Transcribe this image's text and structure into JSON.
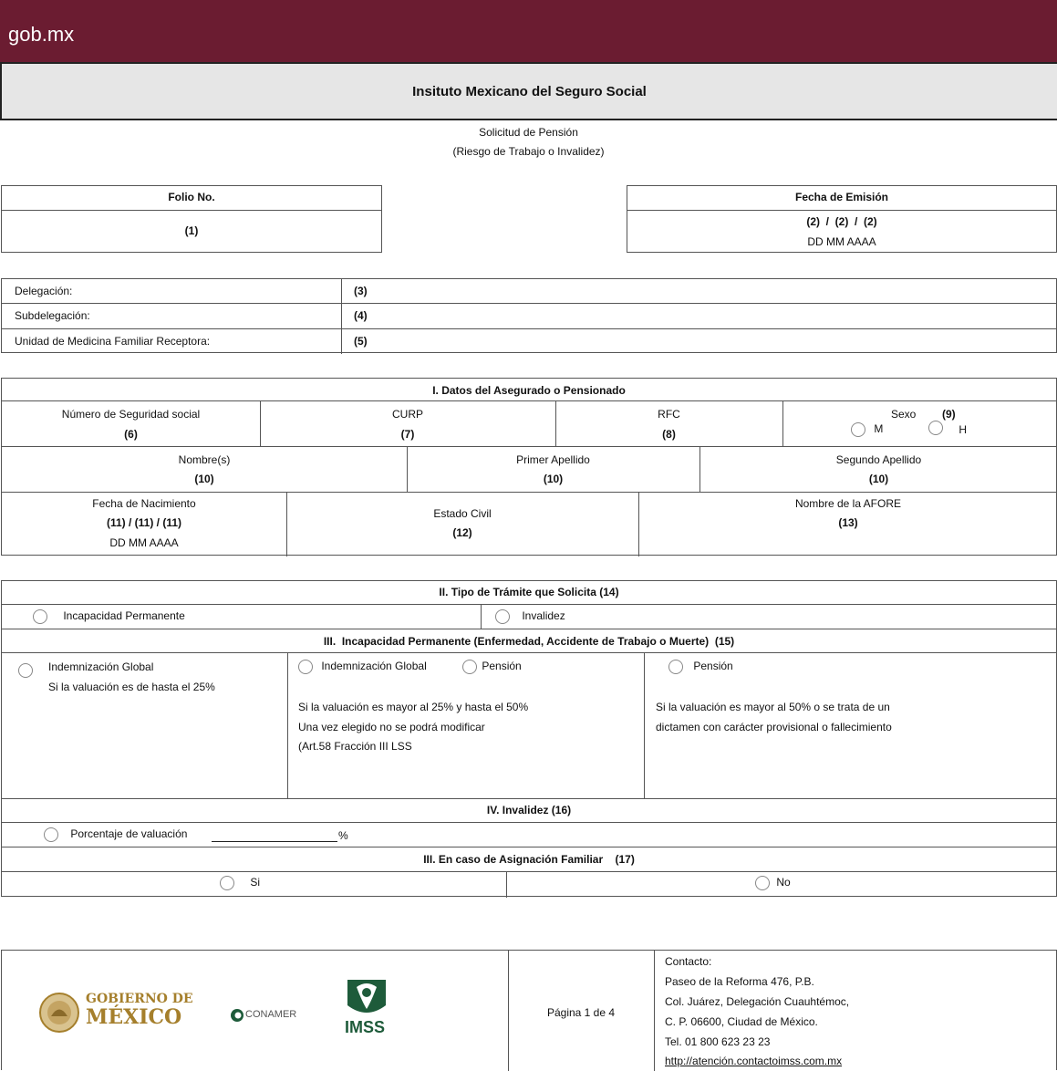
{
  "header": {
    "site": "gob.mx",
    "institution": "Insituto Mexicano del Seguro Social"
  },
  "form": {
    "title": "Solicitud de Pensión",
    "subtitle": "(Riesgo de Trabajo o Invalidez)"
  },
  "folio": {
    "label": "Folio No.",
    "value": "(1)"
  },
  "fecha": {
    "label": "Fecha de Emisión",
    "value": "(2)  /  (2)  /  (2)",
    "format": "DD MM AAAA"
  },
  "location": {
    "rows": [
      {
        "label": "Delegación:",
        "value": "(3)"
      },
      {
        "label": "Subdelegación:",
        "value": "(4)"
      },
      {
        "label": "Unidad de Medicina Familiar Receptora:",
        "value": "(5)"
      }
    ]
  },
  "section1": {
    "title": "I. Datos del Asegurado o Pensionado",
    "nss_label": "Número de Seguridad social",
    "nss_value": "(6)",
    "curp_label": "CURP",
    "curp_value": "(7)",
    "rfc_label": "RFC",
    "rfc_value": "(8)",
    "sexo_label": "Sexo",
    "sexo_value": "(9)",
    "sexo_m": "M",
    "sexo_h": "H",
    "nombre_label": "Nombre(s)",
    "nombre_value": "(10)",
    "primer_label": "Primer Apellido",
    "primer_value": "(10)",
    "segundo_label": "Segundo Apellido",
    "segundo_value": "(10)",
    "nac_label": "Fecha de Nacimiento",
    "nac_value": "(11) / (11) / (11)",
    "nac_format": "DD MM AAAA",
    "civil_label": "Estado Civil",
    "civil_value": "(12)",
    "afore_label": "Nombre de la AFORE",
    "afore_value": "(13)"
  },
  "section2": {
    "title": "II. Tipo de Trámite que Solicita  (14)",
    "opt1": "Incapacidad Permanente",
    "opt2": "Invalidez"
  },
  "section3": {
    "title": "III.  Incapacidad Permanente (Enfermedad, Accidente de Trabajo o Muerte)  (15)",
    "c1_opt": "Indemnización Global",
    "c1_text": "Si la valuación es de hasta el 25%",
    "c2_opt1": "Indemnización Global",
    "c2_opt2": "Pensión",
    "c2_line1": "Si la valuación es mayor al 25% y hasta el 50%",
    "c2_line2": "Una vez elegido no se podrá modificar",
    "c2_line3": "(Art.58 Fracción III LSS",
    "c3_opt": "Pensión",
    "c3_line1": "Si la valuación es mayor al 50% o se trata de un",
    "c3_line2": "dictamen con carácter provisional o fallecimiento"
  },
  "section4": {
    "title": "IV. Invalidez (16)",
    "label": "Porcentaje de valuación",
    "suffix": "%"
  },
  "section5": {
    "title": "III. En caso de Asignación Familiar    (17)",
    "yes": "Si",
    "no": "No"
  },
  "footer": {
    "gob_line1": "GOBIERNO DE",
    "gob_line2": "MÉXICO",
    "conamer": "CONAMER",
    "imss": "IMSS",
    "page": "Página 1 de 4",
    "contact_title": "Contacto:",
    "contact_lines": [
      "Paseo de la Reforma 476, P.B.",
      "Col. Juárez, Delegación Cuauhtémoc,",
      "C. P. 06600, Ciudad de México.",
      "Tel. 01 800 623 23 23"
    ],
    "contact_link": "http://atención.contactoimss.com.mx"
  },
  "colors": {
    "brand": "#6b1c31",
    "gray": "#e6e6e6",
    "gold": "#a57f2c",
    "green": "#1e5b3a"
  }
}
